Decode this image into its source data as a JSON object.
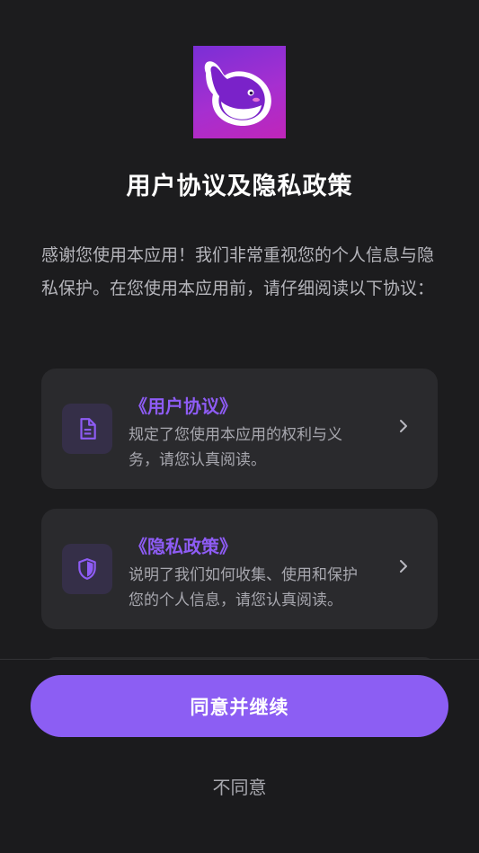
{
  "header": {
    "logo_icon": "whale-logo-icon",
    "title": "用户协议及隐私政策"
  },
  "intro_text": "感谢您使用本应用！我们非常重视您的个人信息与隐私保护。在您使用本应用前，请仔细阅读以下协议：",
  "agreements": [
    {
      "icon": "document-icon",
      "title": "《用户协议》",
      "description": "规定了您使用本应用的权利与义务，请您认真阅读。"
    },
    {
      "icon": "shield-icon",
      "title": "《隐私政策》",
      "description": "说明了我们如何收集、使用和保护您的个人信息，请您认真阅读。"
    }
  ],
  "actions": {
    "agree_label": "同意并继续",
    "disagree_label": "不同意"
  },
  "colors": {
    "accent": "#8c5ef3",
    "background": "#1c1c1e",
    "card": "#2a2a2d"
  }
}
